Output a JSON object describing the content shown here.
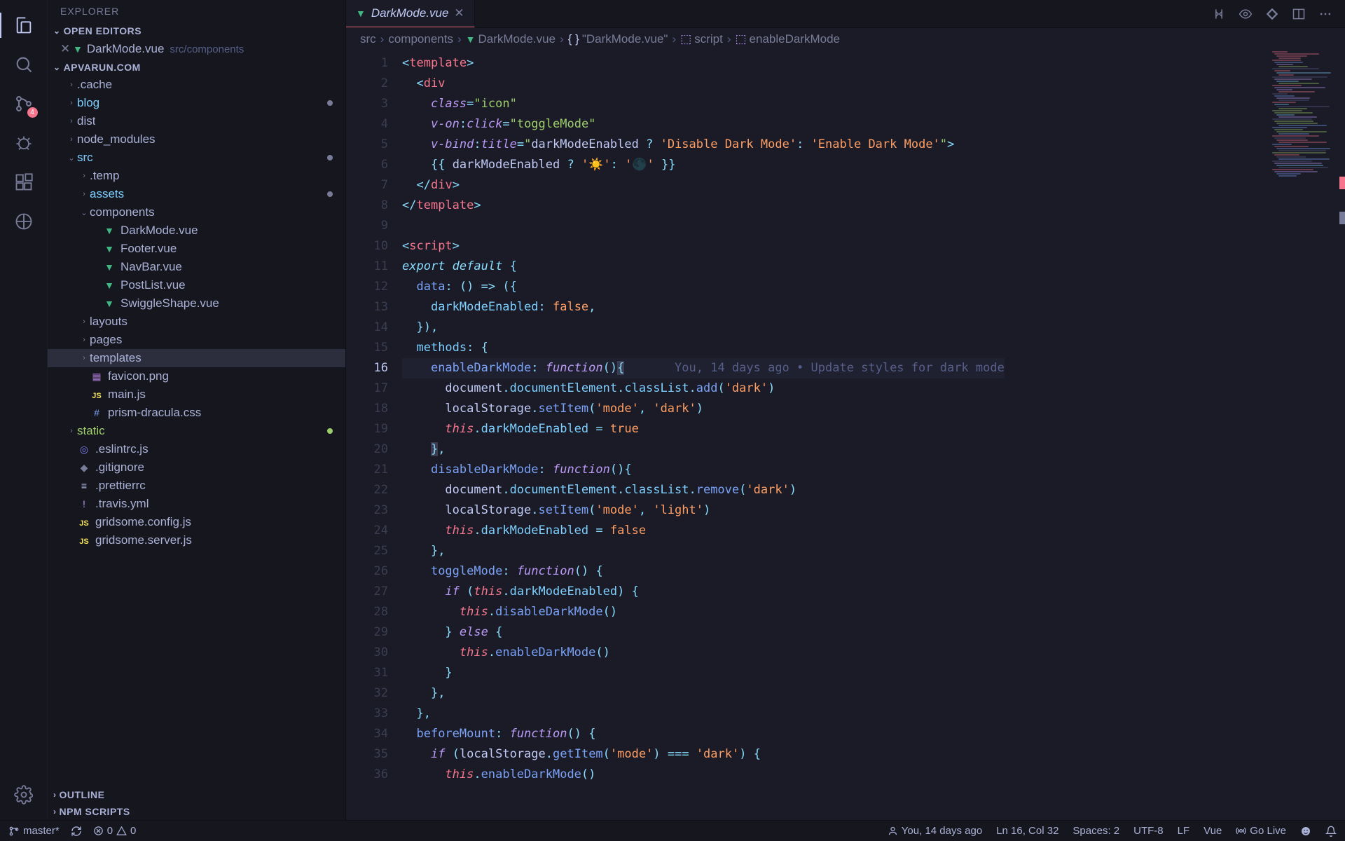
{
  "sidebar_title": "EXPLORER",
  "open_editors_label": "OPEN EDITORS",
  "open_editors": [
    {
      "name": "DarkMode.vue",
      "path": "src/components",
      "icon": "vue"
    }
  ],
  "project_name": "APVARUN.COM",
  "outline_label": "OUTLINE",
  "npm_scripts_label": "NPM SCRIPTS",
  "scm_badge": "4",
  "tree": [
    {
      "name": ".cache",
      "indent": 1,
      "chev": "›",
      "type": "folder"
    },
    {
      "name": "blog",
      "indent": 1,
      "chev": "›",
      "type": "folder",
      "accent": "acc",
      "dot": true
    },
    {
      "name": "dist",
      "indent": 1,
      "chev": "›",
      "type": "folder"
    },
    {
      "name": "node_modules",
      "indent": 1,
      "chev": "›",
      "type": "folder"
    },
    {
      "name": "src",
      "indent": 1,
      "chev": "⌄",
      "type": "folder",
      "accent": "acc",
      "dot": true
    },
    {
      "name": ".temp",
      "indent": 2,
      "chev": "›",
      "type": "folder"
    },
    {
      "name": "assets",
      "indent": 2,
      "chev": "›",
      "type": "folder",
      "accent": "acc",
      "dot": true
    },
    {
      "name": "components",
      "indent": 2,
      "chev": "⌄",
      "type": "folder"
    },
    {
      "name": "DarkMode.vue",
      "indent": 3,
      "type": "file",
      "icon": "vue"
    },
    {
      "name": "Footer.vue",
      "indent": 3,
      "type": "file",
      "icon": "vue"
    },
    {
      "name": "NavBar.vue",
      "indent": 3,
      "type": "file",
      "icon": "vue"
    },
    {
      "name": "PostList.vue",
      "indent": 3,
      "type": "file",
      "icon": "vue"
    },
    {
      "name": "SwiggleShape.vue",
      "indent": 3,
      "type": "file",
      "icon": "vue"
    },
    {
      "name": "layouts",
      "indent": 2,
      "chev": "›",
      "type": "folder"
    },
    {
      "name": "pages",
      "indent": 2,
      "chev": "›",
      "type": "folder"
    },
    {
      "name": "templates",
      "indent": 2,
      "chev": "›",
      "type": "folder",
      "selected": true
    },
    {
      "name": "favicon.png",
      "indent": 2,
      "type": "file",
      "icon": "img"
    },
    {
      "name": "main.js",
      "indent": 2,
      "type": "file",
      "icon": "js"
    },
    {
      "name": "prism-dracula.css",
      "indent": 2,
      "type": "file",
      "icon": "css"
    },
    {
      "name": "static",
      "indent": 1,
      "chev": "›",
      "type": "folder",
      "accent": "green",
      "dot": true,
      "dotc": "#9ece6a"
    },
    {
      "name": ".eslintrc.js",
      "indent": 1,
      "type": "file",
      "icon": "eslint"
    },
    {
      "name": ".gitignore",
      "indent": 1,
      "type": "file",
      "icon": "git"
    },
    {
      "name": ".prettierrc",
      "indent": 1,
      "type": "file",
      "icon": "prettier"
    },
    {
      "name": ".travis.yml",
      "indent": 1,
      "type": "file",
      "icon": "travis"
    },
    {
      "name": "gridsome.config.js",
      "indent": 1,
      "type": "file",
      "icon": "js"
    },
    {
      "name": "gridsome.server.js",
      "indent": 1,
      "type": "file",
      "icon": "js"
    }
  ],
  "tab": {
    "name": "DarkMode.vue"
  },
  "breadcrumbs": [
    "src",
    "components",
    "DarkMode.vue",
    "\"DarkMode.vue\"",
    "script",
    "enableDarkMode"
  ],
  "bc_icons": [
    "",
    "",
    "vue",
    "braces",
    "cube",
    "cube"
  ],
  "blame": "You, 14 days ago • Update styles for dark mode",
  "lines": 36,
  "active_line": 16,
  "status": {
    "branch": "master*",
    "errors": "0",
    "warnings": "0",
    "blame": "You, 14 days ago",
    "pos": "Ln 16, Col 32",
    "spaces": "Spaces: 2",
    "encoding": "UTF-8",
    "eol": "LF",
    "lang": "Vue",
    "golive": "Go Live"
  }
}
